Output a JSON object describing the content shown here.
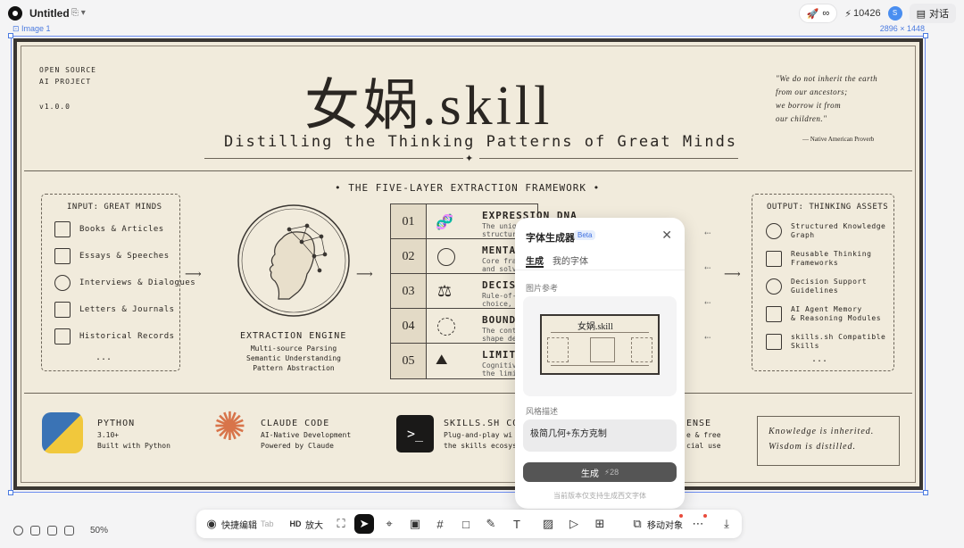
{
  "app": {
    "doc_title": "Untitled",
    "credits": "10426",
    "avatar": "S",
    "chat_label": "对话",
    "infinity": "∞"
  },
  "canvas": {
    "selection_label": "Image 1",
    "selection_size": "2896 × 1448",
    "zoom": "50%"
  },
  "poster": {
    "project": "OPEN SOURCE\nAI PROJECT",
    "version": "v1.0.0",
    "title": "女娲.skill",
    "subtitle": "Distilling the Thinking Patterns of Great Minds",
    "quote": "\"We do not inherit the earth\nfrom our ancestors;\nwe borrow it from\nour children.\"",
    "quote_source": "— Native American Proverb",
    "framework_title": "• THE FIVE-LAYER EXTRACTION FRAMEWORK •",
    "input_title": "INPUT: GREAT MINDS",
    "inputs": [
      "Books & Articles",
      "Essays & Speeches",
      "Interviews & Dialogues",
      "Letters & Journals",
      "Historical Records"
    ],
    "ellipsis": "...",
    "engine_title": "EXTRACTION ENGINE",
    "engine_lines": "Multi-source Parsing\nSemantic Understanding\nPattern Abstraction",
    "layers": [
      {
        "num": "01",
        "title": "EXPRESSION DNA",
        "sub": "The uniqu\nstructuri"
      },
      {
        "num": "02",
        "title": "MENTAL",
        "sub": "Core fram\nand solvi"
      },
      {
        "num": "03",
        "title": "DECIS",
        "sub": "Rule-of-t\nchoice, a"
      },
      {
        "num": "04",
        "title": "BOUND",
        "sub": "The conte\nshape dec"
      },
      {
        "num": "05",
        "title": "LIMITA",
        "sub": "Cognitive\nthe limit"
      }
    ],
    "output_title": "OUTPUT: THINKING ASSETS",
    "outputs": [
      "Structured Knowledge\nGraph",
      "Reusable Thinking\nFrameworks",
      "Decision Support\nGuidelines",
      "AI Agent Memory\n& Reasoning Modules",
      "skills.sh Compatible\nSkills"
    ],
    "bottom": [
      {
        "title": "PYTHON",
        "lines": "3.10+\nBuilt with Python"
      },
      {
        "title": "CLAUDE CODE",
        "lines": "AI-Native Development\nPowered by Claude"
      },
      {
        "title": "SKILLS.SH COM",
        "lines": "Plug-and-play wi\nthe skills ecosys"
      },
      {
        "title": "ENSE",
        "lines": "e & free\ncial use"
      }
    ],
    "motto": "Knowledge is inherited.\nWisdom is distilled."
  },
  "modal": {
    "title": "字体生成器",
    "beta": "Beta",
    "tab_generate": "生成",
    "tab_mine": "我的字体",
    "image_ref_label": "图片参考",
    "thumb_title": "女娲.skill",
    "style_label": "风格描述",
    "style_value": "极简几何+东方克制",
    "generate_label": "生成",
    "generate_cost": "28",
    "note": "当前版本仅支持生成西文字体"
  },
  "toolbar": {
    "quick_edit": "快捷编辑",
    "quick_edit_hint": "Tab",
    "upscale": "放大",
    "move_object": "移动对象"
  },
  "colors": {
    "poster_bg": "#f1ebdc",
    "accent_blue": "#3c6ee0",
    "sel_blue": "#6b8cf0"
  }
}
